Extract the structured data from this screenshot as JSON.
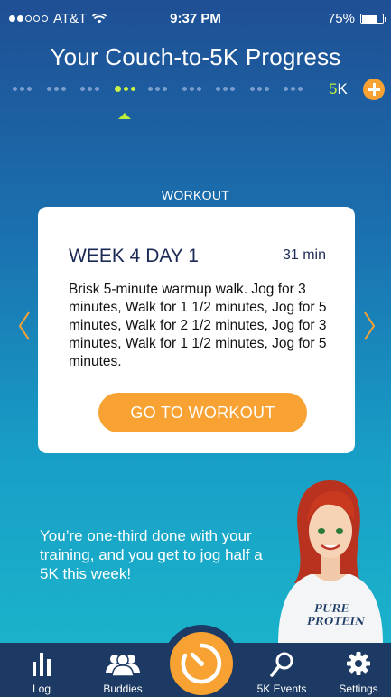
{
  "status_bar": {
    "carrier": "AT&T",
    "time": "9:37 PM",
    "battery": "75%",
    "battery_level": 0.75,
    "signal_bars": 2,
    "signal_total": 5
  },
  "header": {
    "title": "Your Couch-to-5K Progress"
  },
  "progress": {
    "weeks_total": 9,
    "days_per_week": 3,
    "current_week": 4,
    "current_day": 1,
    "goal_label_number": "5",
    "goal_label_unit": "K",
    "current_color": "#c8f047"
  },
  "workout": {
    "section_label": "WORKOUT",
    "title": "WEEK 4 DAY 1",
    "duration": "31 min",
    "description": "Brisk 5-minute warmup walk.  Jog for 3 minutes, Walk for 1 1/2 minutes, Jog for 5 minutes, Walk for 2 1/2 minutes, Jog for 3 minutes, Walk for 1 1/2 minutes, Jog for 5 minutes.",
    "button_label": "GO TO WORKOUT"
  },
  "motivation": {
    "text": "You’re one-third done with your training, and you get to jog half a 5K this week!"
  },
  "coach": {
    "shirt_line1": "PURE",
    "shirt_line2": "PROTEIN"
  },
  "tab_bar": {
    "items": [
      {
        "label": "Log",
        "icon": "bar-chart-icon"
      },
      {
        "label": "Buddies",
        "icon": "buddies-icon"
      },
      {
        "label": "",
        "icon": "timer-icon"
      },
      {
        "label": "5K Events",
        "icon": "search-pin-icon"
      },
      {
        "label": "Settings",
        "icon": "gear-icon"
      }
    ]
  },
  "colors": {
    "accent": "#f7a233",
    "card_text": "#1c2b55",
    "tab_bar": "#1c3a63",
    "progress_current": "#c8f047"
  }
}
